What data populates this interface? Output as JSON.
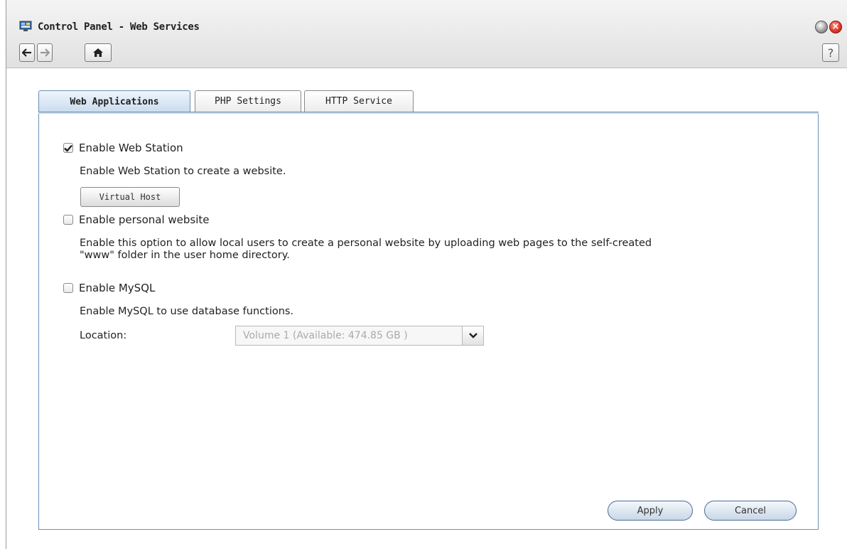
{
  "window": {
    "title": "Control Panel - Web Services",
    "close_glyph": "×",
    "help_glyph": "?"
  },
  "nav": {
    "back_icon": "arrow-left-icon",
    "forward_icon": "arrow-right-icon",
    "home_icon": "home-icon"
  },
  "tabs": [
    {
      "label": "Web Applications",
      "active": true
    },
    {
      "label": "PHP Settings",
      "active": false
    },
    {
      "label": "HTTP Service",
      "active": false
    }
  ],
  "web_station": {
    "label": "Enable Web Station",
    "checked": true,
    "description": "Enable Web Station to create a website.",
    "virtual_host_label": "Virtual Host"
  },
  "personal_website": {
    "label": "Enable personal website",
    "checked": false,
    "description_line1": "Enable this option to allow local users to create a personal website by uploading web pages to the self-created",
    "description_line2": "\"www\" folder in the user home directory."
  },
  "mysql": {
    "label": "Enable MySQL",
    "checked": false,
    "description": "Enable MySQL to use database functions.",
    "location_label": "Location:",
    "location_value": "Volume 1 (Available: 474.85 GB )"
  },
  "buttons": {
    "apply": "Apply",
    "cancel": "Cancel"
  },
  "colors": {
    "accent": "#6b8fb5",
    "close": "#e03a2a"
  }
}
